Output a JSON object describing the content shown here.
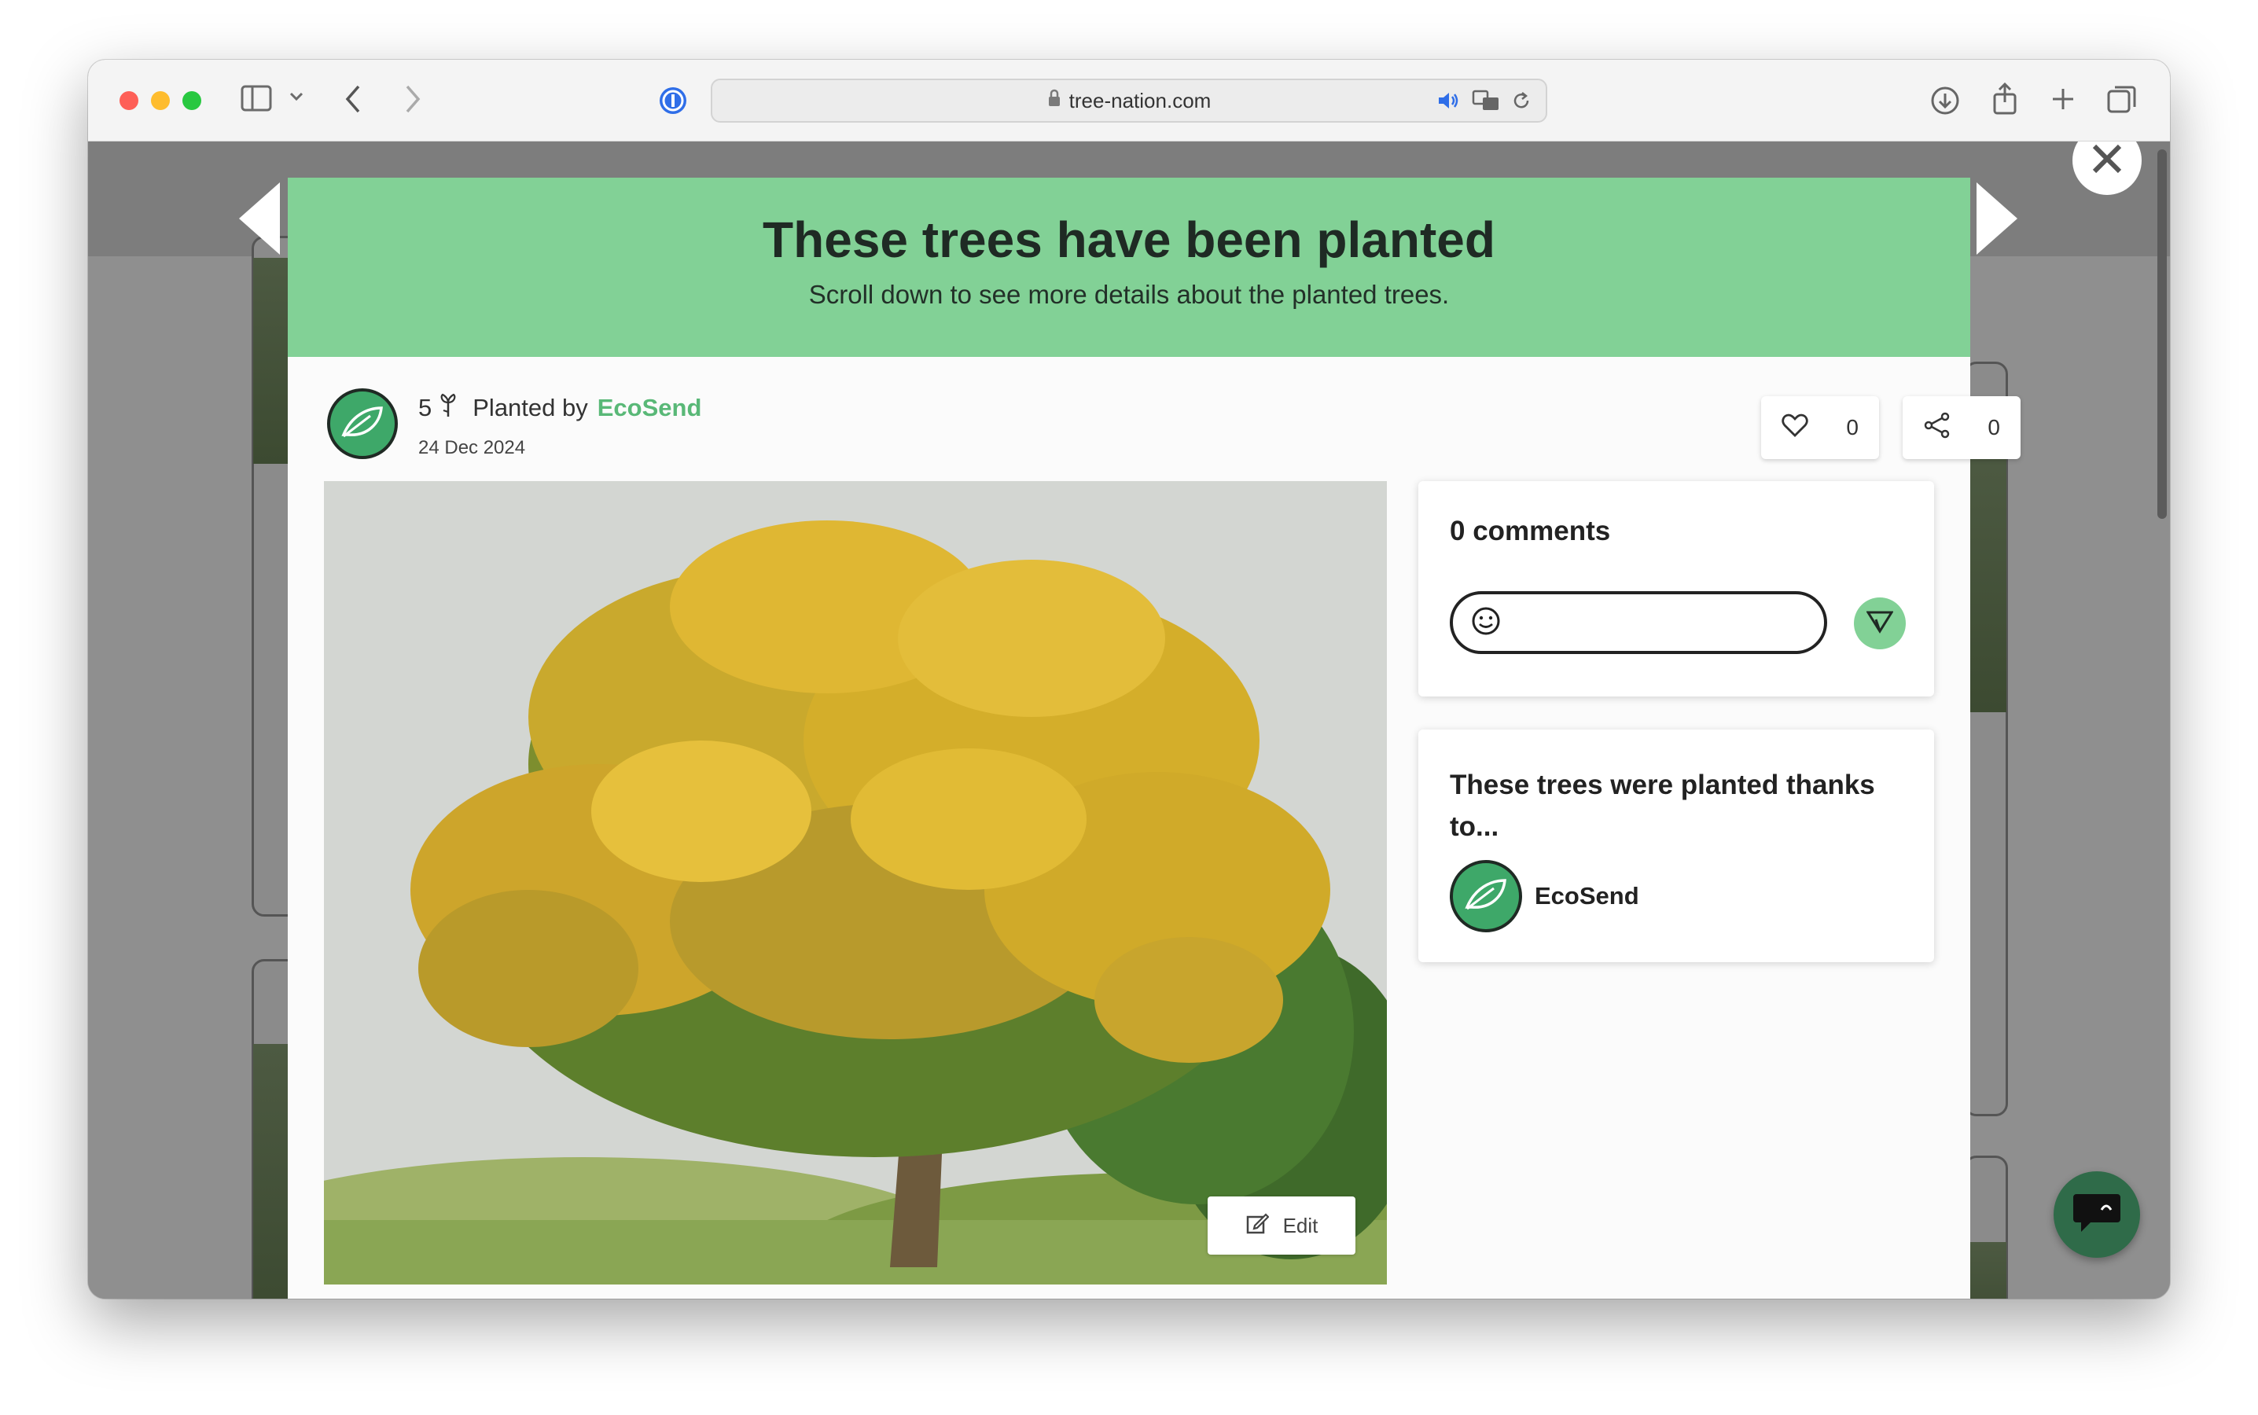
{
  "browser": {
    "url": "tree-nation.com"
  },
  "modal": {
    "title": "These trees have been planted",
    "subtitle": "Scroll down to see more details about the planted trees.",
    "tree_count": "5",
    "planted_by_label": "Planted by",
    "planter_name": "EcoSend",
    "date": "24 Dec 2024",
    "likes": "0",
    "shares": "0",
    "edit_label": "Edit"
  },
  "comments": {
    "title": "0 comments"
  },
  "thanks": {
    "title": "These trees were planted thanks to...",
    "sponsor_name": "EcoSend"
  },
  "colors": {
    "header_green": "#82d196",
    "accent_green": "#59b877",
    "avatar_green": "#3ea869"
  },
  "icons": [
    "sidebar-icon",
    "chevron-down-icon",
    "back-icon",
    "forward-icon",
    "password-manager-icon",
    "lock-icon",
    "speaker-icon",
    "translate-icon",
    "reload-icon",
    "download-icon",
    "share-icon",
    "new-tab-icon",
    "tabs-overview-icon",
    "close-icon",
    "heart-icon",
    "share-nodes-icon",
    "smiley-icon",
    "send-icon",
    "edit-icon",
    "leaf-icon",
    "sprout-icon",
    "chat-icon"
  ]
}
